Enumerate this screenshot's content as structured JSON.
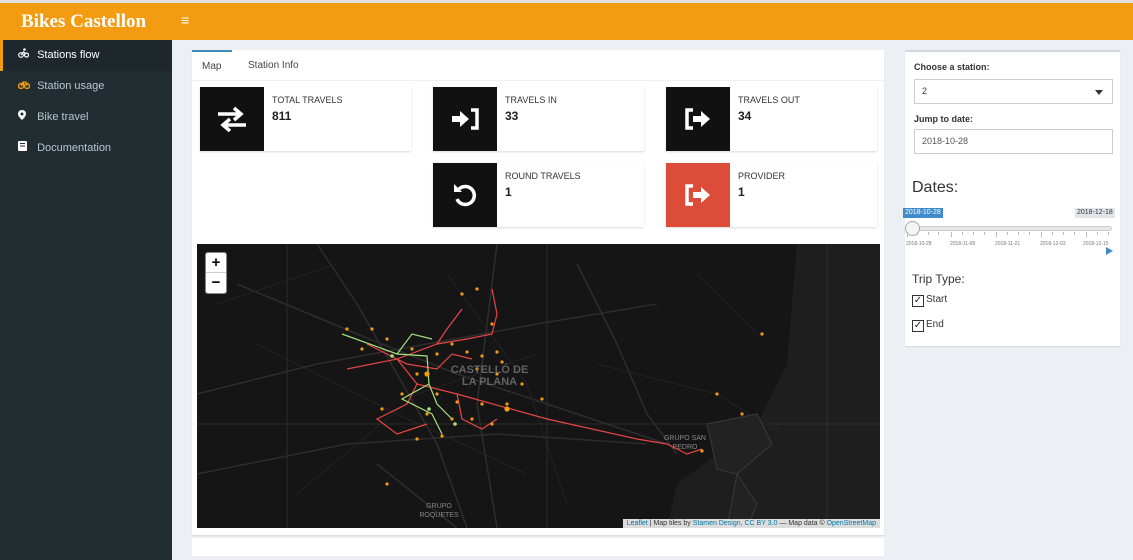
{
  "app": {
    "title": "Bikes Castellon",
    "menu_icon": "hamburger-icon"
  },
  "sidebar": {
    "items": [
      {
        "label": "Stations flow",
        "icon": "cyclist-icon",
        "active": true
      },
      {
        "label": "Station usage",
        "icon": "bicycle-icon",
        "active": false
      },
      {
        "label": "Bike travel",
        "icon": "map-marker-icon",
        "active": false
      },
      {
        "label": "Documentation",
        "icon": "book-icon",
        "active": false
      }
    ]
  },
  "tabs": [
    {
      "label": "Map",
      "active": true
    },
    {
      "label": "Station Info",
      "active": false
    }
  ],
  "stats": {
    "total_travels": {
      "label": "TOTAL TRAVELS",
      "value": "811",
      "icon": "exchange-arrows-icon"
    },
    "travels_in": {
      "label": "TRAVELS IN",
      "value": "33",
      "icon": "sign-in-icon"
    },
    "travels_out": {
      "label": "TRAVELS OUT",
      "value": "34",
      "icon": "sign-out-icon"
    },
    "round_travels": {
      "label": "ROUND TRAVELS",
      "value": "1",
      "icon": "undo-icon"
    },
    "provider": {
      "label": "PROVIDER",
      "value": "1",
      "icon": "sign-out-icon",
      "color": "#dd4b39"
    }
  },
  "map": {
    "labels": [
      "CASTELLÓ DE LA PLANA",
      "GRUPO SAN PEDRO",
      "GRUPO ROQUETES"
    ],
    "zoom_in": "+",
    "zoom_out": "−",
    "attribution": {
      "leaflet": "Leaflet",
      "tiles_prefix": " | Map tiles by ",
      "stamen": "Stamen Design, CC BY 3.0",
      "data_prefix": " — Map data © ",
      "osm": "OpenStreetMap"
    },
    "colors": {
      "route_out": "#e84545",
      "route_in": "#a6e07a",
      "station": "#f39c12",
      "background": "#151515"
    }
  },
  "controls": {
    "station_label": "Choose a station:",
    "station_value": "2",
    "jump_label": "Jump to date:",
    "jump_value": "2018-10-28",
    "dates_title": "Dates:",
    "slider": {
      "from": "2018-10-28",
      "to": "2018-12-18",
      "selected": "2018-10-28",
      "tick_labels": [
        "2018-10-28",
        "2018-11-09",
        "2018-11-21",
        "2018-12-03",
        "2018-12-15"
      ]
    },
    "trip_type_title": "Trip Type:",
    "trip_types": [
      {
        "label": "Start",
        "checked": true
      },
      {
        "label": "End",
        "checked": true
      }
    ]
  },
  "theme": {
    "header": "#f39c12",
    "sidebar": "#222d32",
    "accent": "#3c8dbc"
  }
}
